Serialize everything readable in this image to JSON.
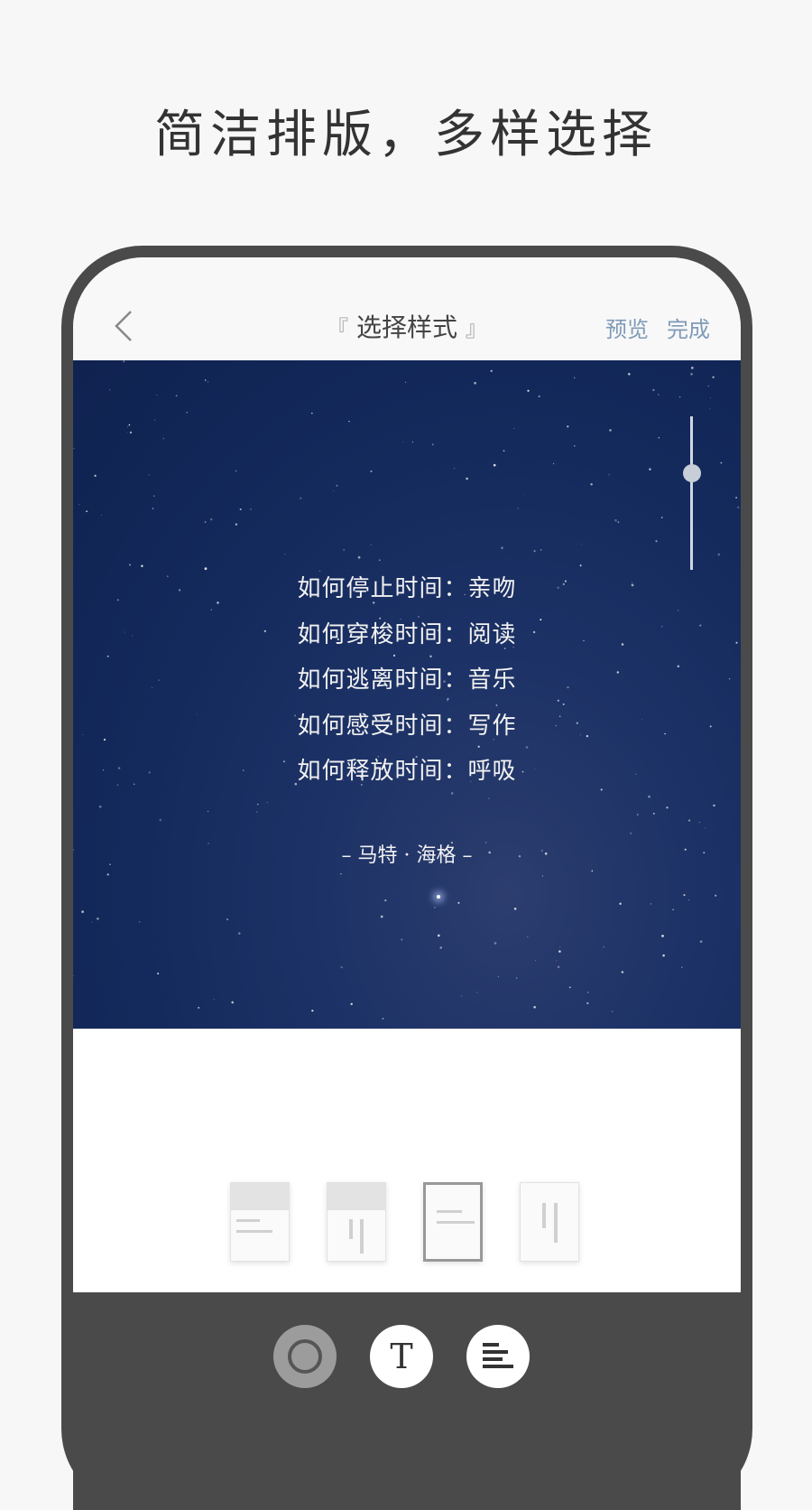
{
  "promo": {
    "title": "简洁排版，多样选择"
  },
  "navbar": {
    "title": "选择样式",
    "bracket_left": "『",
    "bracket_right": "』",
    "actions": [
      "预览",
      "完成"
    ],
    "back_icon": "chevron-left-icon"
  },
  "card": {
    "background_color": "#142a5c",
    "poem_lines": [
      "如何停止时间：亲吻",
      "如何穿梭时间：阅读",
      "如何逃离时间：音乐",
      "如何感受时间：写作",
      "如何释放时间：呼吸"
    ],
    "author": "– 马特 · 海格 –",
    "slider_value": 0.35
  },
  "layout_options": {
    "selected_index": 2,
    "items": [
      "header-lines",
      "header-vertical",
      "lines",
      "vertical"
    ]
  },
  "toolbar": {
    "buttons": [
      {
        "icon": "circle-icon",
        "active": true
      },
      {
        "icon": "text-icon",
        "label": "T",
        "active": false
      },
      {
        "icon": "align-left-icon",
        "active": false
      }
    ]
  },
  "colors": {
    "toolbar": "#4a4a4a",
    "accent": "#7f9ab8",
    "card": "#142a5c"
  }
}
